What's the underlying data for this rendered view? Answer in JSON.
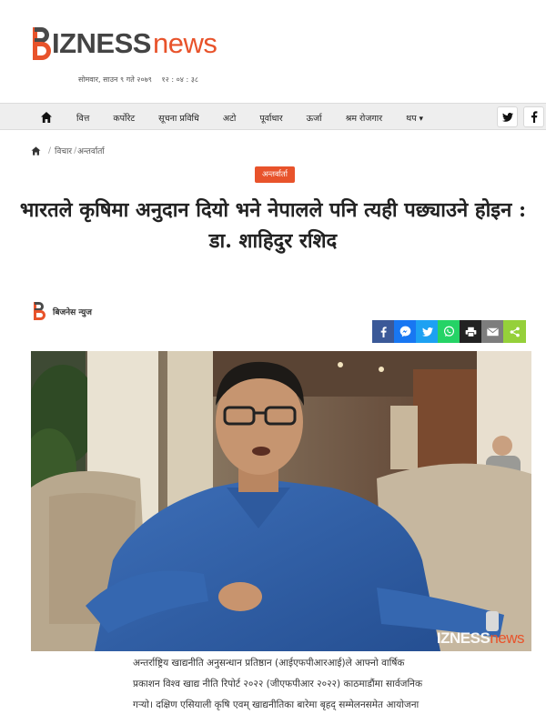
{
  "header": {
    "logo_text_bold": "IZNESS",
    "logo_text_light": "news",
    "date": "सोमवार, साउन ९ गते २०७९",
    "time": "१२ : ०४ : ३८"
  },
  "nav": {
    "items": [
      {
        "label": "वित्त"
      },
      {
        "label": "कर्पोरेट"
      },
      {
        "label": "सूचना प्रविधि"
      },
      {
        "label": "अटो"
      },
      {
        "label": "पूर्वाधार"
      },
      {
        "label": "ऊर्जा"
      },
      {
        "label": "श्रम रोजगार"
      },
      {
        "label": "थप"
      }
    ],
    "social": [
      {
        "label": "t",
        "icon": "twitter-icon"
      },
      {
        "label": "f",
        "icon": "facebook-icon"
      }
    ]
  },
  "breadcrumb": {
    "section": "विचार",
    "current": "अन्तर्वार्ता"
  },
  "article": {
    "category": "अन्तर्वार्ता",
    "title": "भारतले कृषिमा अनुदान दियो भने नेपालले पनि त्यही पछ्याउने होइन : डा. शाहिदुर रशिद",
    "author": "बिजनेस न्युज",
    "photo_watermark_a": "IZNESS",
    "photo_watermark_b": "news",
    "body_lines": [
      "अन्तर्राष्ट्रिय खाद्यनीति अनुसन्धान प्रतिष्ठान (आईएफपीआरआई)ले आफ्नो वार्षिक",
      "प्रकाशन विश्व खाद्य नीति रिपोर्ट २०२२ (जीएफपीआर २०२२) काठमाडौंमा सार्वजनिक",
      "गर्‍यो। दक्षिण एसियाली कृषि एवम् खाद्यनीतिका बारेमा बृहद् सम्मेलनसमेत आयोजना"
    ]
  },
  "share_buttons": [
    {
      "icon": "facebook-icon",
      "color": "#3b5998",
      "glyph": "f"
    },
    {
      "icon": "messenger-icon",
      "color": "#1877f2",
      "glyph": "m"
    },
    {
      "icon": "twitter-icon",
      "color": "#1da1f2",
      "glyph": "t"
    },
    {
      "icon": "whatsapp-icon",
      "color": "#25d366",
      "glyph": "w"
    },
    {
      "icon": "print-icon",
      "color": "#222222",
      "glyph": "p"
    },
    {
      "icon": "email-icon",
      "color": "#7d7d7d",
      "glyph": "e"
    },
    {
      "icon": "share-icon",
      "color": "#95d03a",
      "glyph": "s"
    }
  ],
  "colors": {
    "brand": "#e8532b",
    "nav_bg": "#eeeeee"
  }
}
